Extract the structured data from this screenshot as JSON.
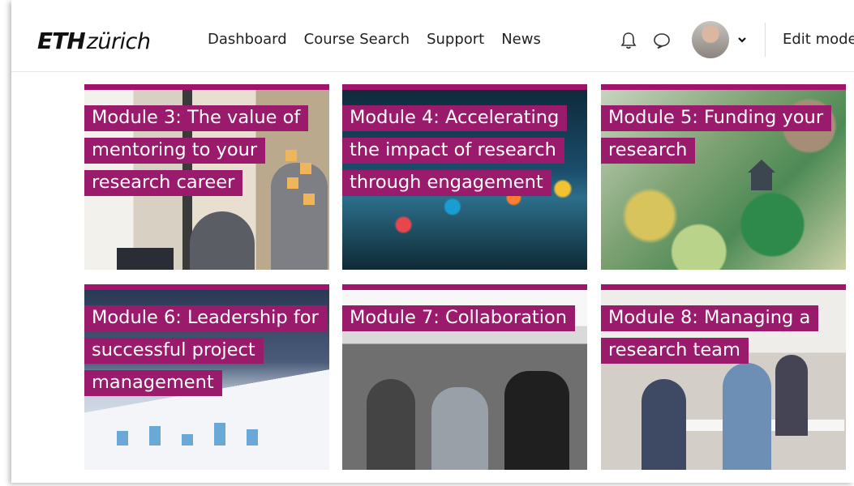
{
  "brand": {
    "part1": "ETH",
    "part2": "zürich"
  },
  "nav": {
    "links": [
      "Dashboard",
      "Course Search",
      "Support",
      "News"
    ],
    "edit_mode_label": "Edit mode"
  },
  "colors": {
    "accent": "#9a1a6c",
    "text": "#222222"
  },
  "icons": [
    "bell-icon",
    "chat-icon",
    "avatar",
    "chevron-down-icon"
  ],
  "modules": [
    {
      "title": "Module 3: The value of mentoring to your research career"
    },
    {
      "title": "Module 4: Accelerating the impact of research through engagement"
    },
    {
      "title": "Module 5: Funding your research"
    },
    {
      "title": "Module 6: Leadership for successful project management"
    },
    {
      "title": "Module 7: Collaboration"
    },
    {
      "title": "Module 8: Managing a research team"
    }
  ]
}
